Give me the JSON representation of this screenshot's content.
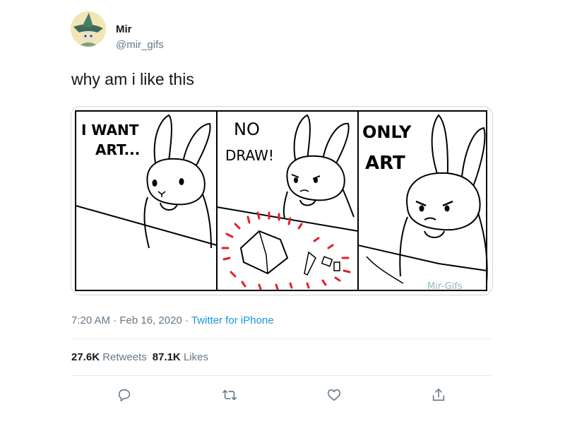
{
  "tweet": {
    "author": {
      "display_name": "Mir",
      "handle": "@mir_gifs",
      "avatar_icon": "witch-hat-avatar"
    },
    "text": "why am i like this",
    "media": {
      "panel1_text_line1": "I WANT",
      "panel1_text_line2": "ART...",
      "panel2_text_line1": "NO",
      "panel2_text_line2": "DRAW!",
      "panel3_text_line1": "ONLY",
      "panel3_text_line2": "ART",
      "watermark": "Mir-Gifs"
    },
    "time": "7:20 AM",
    "date": "Feb 16, 2020",
    "separator": "·",
    "source": "Twitter for iPhone",
    "stats": {
      "retweets_count": "27.6K",
      "retweets_label": "Retweets",
      "likes_count": "87.1K",
      "likes_label": "Likes"
    },
    "actions": {
      "reply_icon": "reply-icon",
      "retweet_icon": "retweet-icon",
      "like_icon": "heart-icon",
      "share_icon": "share-icon"
    }
  },
  "colors": {
    "text_primary": "#14171a",
    "text_secondary": "#657786",
    "link": "#1b95e0",
    "border": "#e6ecf0",
    "alert_red": "#e0202a"
  }
}
